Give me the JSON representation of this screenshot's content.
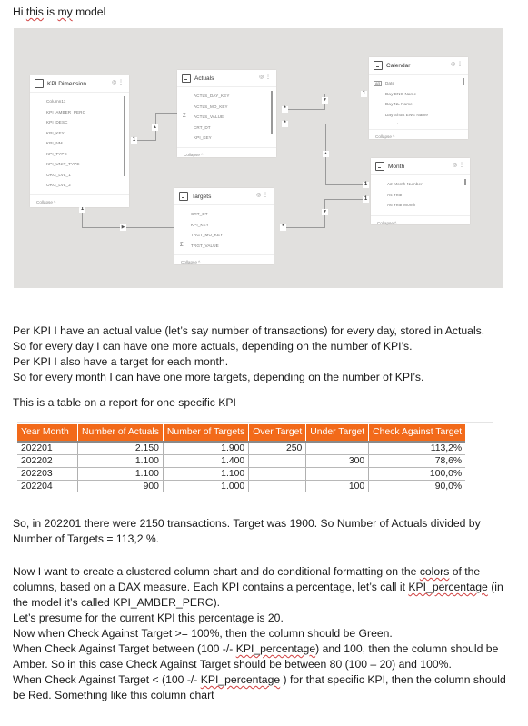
{
  "intro": "Hi this is my model",
  "diagram": {
    "tables": [
      {
        "name": "KPI Dimension",
        "fields": [
          {
            "label": "Column11"
          },
          {
            "label": "KPI_AMBER_PERC"
          },
          {
            "label": "KPI_DESC"
          },
          {
            "label": "KPI_KEY"
          },
          {
            "label": "KPI_NM"
          },
          {
            "label": "KPI_TYPE"
          },
          {
            "label": "KPI_UNIT_TYPE"
          },
          {
            "label": "ORG_LVL_1"
          },
          {
            "label": "ORG_LVL_2"
          }
        ],
        "collapse": "Collapse ^"
      },
      {
        "name": "Actuals",
        "fields": [
          {
            "label": "ACTLS_DAY_KEY"
          },
          {
            "label": "ACTLS_MO_KEY"
          },
          {
            "label": "ACTLS_VALUE",
            "sum": true
          },
          {
            "label": "CRT_DT"
          },
          {
            "label": "KPI_KEY"
          }
        ],
        "collapse": "Collapse ^"
      },
      {
        "name": "Targets",
        "fields": [
          {
            "label": "CRT_DT"
          },
          {
            "label": "KPI_KEY"
          },
          {
            "label": "TRGT_MO_KEY"
          },
          {
            "label": "TRGT_VALUE",
            "sum": true
          }
        ],
        "collapse": "Collapse ^"
      },
      {
        "name": "Calendar",
        "fields": [
          {
            "label": "Date",
            "badge": "A⊟"
          },
          {
            "label": "Day ENG Name"
          },
          {
            "label": "Day NL Name"
          },
          {
            "label": "Day Short ENG Name"
          },
          {
            "label": "Day Short NL Name"
          }
        ],
        "collapse": "Collapse ^"
      },
      {
        "name": "Month",
        "fields": [
          {
            "label": "A2 Month Number"
          },
          {
            "label": "A4 Year"
          },
          {
            "label": "A6 Year Month"
          }
        ],
        "collapse": "Collapse ^"
      }
    ],
    "cardinality": {
      "one": "1",
      "many": "*"
    },
    "icons": {
      "visibility": "eye-icon",
      "more": "more-options-icon",
      "table": "table-icon",
      "sum": "sigma-icon"
    }
  },
  "paragraphs1": [
    "Per KPI I have an actual value (let’s say number of transactions) for every day, stored in Actuals.",
    "So for every day I can have one more actuals, depending on the number of KPI’s.",
    "Per KPI I also have a target for each month.",
    "So for every month I can have one more targets, depending on the number of KPI’s."
  ],
  "table_intro": "This is a table on a report for one specific KPI",
  "report_table": {
    "header_color": "#f26a1a",
    "columns": [
      "Year Month",
      "Number of Actuals",
      "Number of Targets",
      "Over Target",
      "Under Target",
      "Check Against Target"
    ],
    "rows": [
      [
        "202201",
        "2.150",
        "1.900",
        "250",
        "",
        "113,2%"
      ],
      [
        "202202",
        "1.100",
        "1.400",
        "",
        "300",
        "78,6%"
      ],
      [
        "202203",
        "1.100",
        "1.100",
        "",
        "",
        "100,0%"
      ],
      [
        "202204",
        "900",
        "1.000",
        "",
        "100",
        "90,0%"
      ]
    ]
  },
  "paragraphs2": [
    "So, in 202201 there were 2150 transactions. Target was 1900. So Number of Actuals divided by",
    "Number of Targets = 113,2 %."
  ],
  "paragraphs3": {
    "l1": "Now I want to create a clustered column chart and do conditional formatting  on the ",
    "l1_sq": "colors",
    "l1_end": " of the",
    "l2": "columns, based on a DAX measure. Each KPI contains a percentage, let’s call it ",
    "l2_sq": "KPI_percentage",
    "l2_end": " (in",
    "l3": "the model it’s called KPI_AMBER_PERC).",
    "l4": "Let’s presume for the current KPI this percentage is 20.",
    "l5": "Now when Check Against Target >= 100%, then the column should be Green.",
    "l6": "When Check Against Target between (100  -/- ",
    "l6_sq": "KPI_percentage",
    "l6_end": ") and 100, then the column should be",
    "l7": "Amber. So in this case Check Against Target should be between 80 (100 – 20)  and 100%.",
    "l8": "When Check Against Target < (100 -/- ",
    "l8_sq": "KPI_percentage",
    "l8_end": " ) for that specific KPI, then the column should",
    "l9": "be Red. Something like this column chart"
  }
}
